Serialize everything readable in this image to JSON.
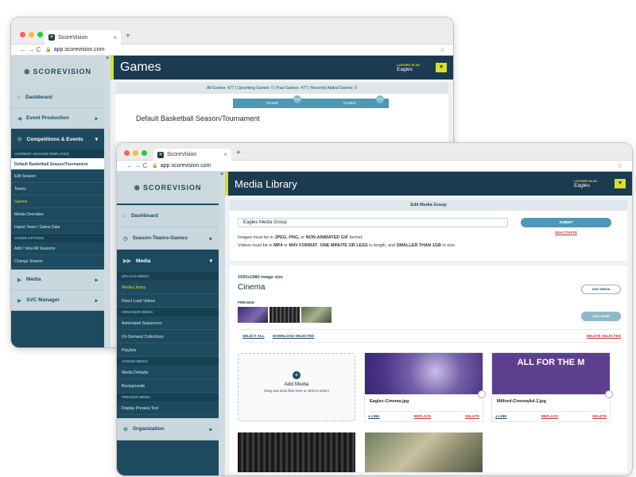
{
  "back_window": {
    "tab_title": "ScoreVision",
    "url": "app.scorevision.com",
    "logo": "SCOREVISION",
    "sidebar": {
      "items": [
        {
          "label": "Dashboard",
          "icon": "home-icon"
        },
        {
          "label": "Event Production",
          "icon": "megaphone-icon"
        }
      ],
      "active": "Competitions & Events",
      "section_current": "CURRENT SEASON DISPLAYED",
      "sub_items": [
        {
          "label": "Default Basketball Season/Tournament",
          "state": "selected"
        },
        {
          "label": "Edit Season",
          "state": ""
        },
        {
          "label": "Teams",
          "state": ""
        },
        {
          "label": "Games",
          "state": "highlight"
        },
        {
          "label": "Media Overrides",
          "state": ""
        },
        {
          "label": "Import Team / Game Data",
          "state": ""
        }
      ],
      "section_other": "OTHER OPTIONS",
      "other_items": [
        {
          "label": "Add / View All Seasons"
        },
        {
          "label": "Change Season"
        }
      ],
      "bottom_items": [
        {
          "label": "Media",
          "icon": "play-icon"
        },
        {
          "label": "SVC Manager",
          "icon": "play-icon"
        }
      ]
    },
    "header": {
      "title": "Games",
      "logged_in_label": "LOGGED IN AS",
      "user": "Eagles"
    },
    "stats": "All Games: 477 | Upcoming Games: 0 | Past Games: 477 | Recently Added Games: 0",
    "steps": [
      {
        "label": "TEAMS",
        "badge": "102"
      },
      {
        "label": "GAMES",
        "badge": "477"
      }
    ],
    "season_title": "Default Basketball Season/Tournament"
  },
  "front_window": {
    "tab_title": "ScoreVision",
    "url": "app.scorevision.com",
    "logo": "SCOREVISION",
    "sidebar": {
      "items": [
        {
          "label": "Dashboard",
          "icon": "home-icon"
        },
        {
          "label": "Season-Teams-Games",
          "icon": "clock-icon"
        }
      ],
      "active": "Media",
      "groups": [
        {
          "section": "UPLOAD MEDIA",
          "items": [
            {
              "label": "Media Library",
              "state": "highlight"
            },
            {
              "label": "Direct Load Videos",
              "state": ""
            }
          ]
        },
        {
          "section": "ORGANIZE MEDIA",
          "items": [
            {
              "label": "Automated Sequences",
              "state": ""
            },
            {
              "label": "On Demand Collections",
              "state": ""
            },
            {
              "label": "Playlists",
              "state": ""
            }
          ]
        },
        {
          "section": "ASSIGN MEDIA",
          "items": [
            {
              "label": "Media Defaults",
              "state": ""
            },
            {
              "label": "Backgrounds",
              "state": ""
            }
          ]
        },
        {
          "section": "PREVIEW MEDIA",
          "items": [
            {
              "label": "Display Preview Tool",
              "state": ""
            }
          ]
        }
      ],
      "bottom_items": [
        {
          "label": "Organization",
          "icon": "gears-icon"
        }
      ]
    },
    "header": {
      "title": "Media Library",
      "logged_in_label": "LOGGED IN AS",
      "user": "Eagles"
    },
    "edit_group": {
      "title": "Edit Media Group",
      "name_value": "Eagles Media Group",
      "submit": "SUBMIT",
      "deactivate": "DEACTIVATE",
      "help_line1_a": "Images must be in ",
      "help_line1_b": "JPEG, PNG,",
      "help_line1_c": " or ",
      "help_line1_d": "NON-ANIMATED GIF",
      "help_line1_e": " format.",
      "help_line2_a": "Videos must be in ",
      "help_line2_b": "MP4",
      "help_line2_c": " or ",
      "help_line2_d": "M4V FORMAT",
      "help_line2_e": ", ",
      "help_line2_f": "ONE MINUTE OR LESS",
      "help_line2_g": " in length, and ",
      "help_line2_h": "SMALLER THAN 1GB",
      "help_line2_i": " in size."
    },
    "cinema": {
      "size_label": "1920x1080 image size",
      "title": "Cinema",
      "add_media": "ADD MEDIA",
      "preview_label": "PREVIEW",
      "collapse": "COLLAPSE",
      "select_all": "SELECT ALL",
      "download_selected": "DOWNLOAD SELECTED",
      "delete_selected": "DELETE SELECTED",
      "dropzone_title": "Add Media",
      "dropzone_sub": "Drag and drop files here or click to select",
      "files": [
        {
          "name": "Eagles-Cinema.jpg",
          "link": "LINK",
          "replace": "REPLACE",
          "delete": "DELETE"
        },
        {
          "name": "Milford-CinemaAd-2.jpg",
          "link": "LINK",
          "replace": "REPLACE",
          "delete": "DELETE",
          "overlay_text": "ALL FOR THE M"
        }
      ]
    }
  },
  "colors": {
    "navy": "#1b3b50",
    "teal": "#1d4a5f",
    "accent_yellow": "#d9df2b",
    "button_blue": "#4d98b4",
    "danger_red": "#c23a36",
    "purple": "#5e3f8f"
  }
}
